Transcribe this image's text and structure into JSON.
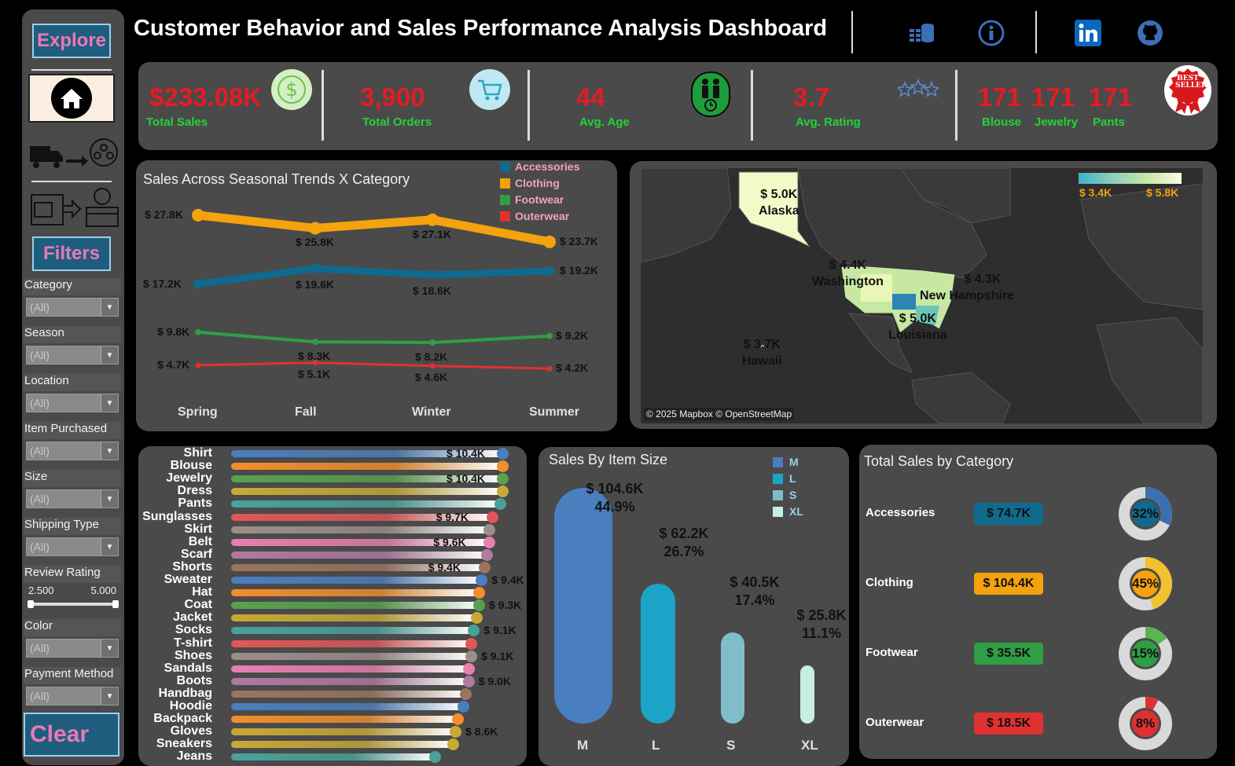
{
  "header": {
    "title": "Customer Behavior and Sales Performance Analysis Dashboard",
    "icons": [
      "data-source-icon",
      "info-icon",
      "linkedin-icon",
      "github-icon"
    ]
  },
  "sidebar": {
    "explore_label": "Explore",
    "filters_label": "Filters",
    "clear_label": "Clear",
    "filters": [
      {
        "label": "Category",
        "value": "(All)"
      },
      {
        "label": "Season",
        "value": "(All)"
      },
      {
        "label": "Location",
        "value": "(All)"
      },
      {
        "label": "Item Purchased",
        "value": "(All)"
      },
      {
        "label": "Size",
        "value": "(All)"
      },
      {
        "label": "Shipping Type",
        "value": "(All)"
      }
    ],
    "review_rating": {
      "label": "Review Rating",
      "min": "2.500",
      "max": "5.000"
    },
    "filters2": [
      {
        "label": "Color",
        "value": "(All)"
      },
      {
        "label": "Payment Method",
        "value": "(All)"
      }
    ]
  },
  "kpi": {
    "total_sales": {
      "value": "$233.08K",
      "label": "Total Sales"
    },
    "total_orders": {
      "value": "3,900",
      "label": "Total Orders"
    },
    "avg_age": {
      "value": "44",
      "label": "Avg. Age"
    },
    "avg_rating": {
      "value": "3.7",
      "label": "Avg. Rating"
    },
    "best_sellers": [
      {
        "value": "171",
        "label": "Blouse"
      },
      {
        "value": "171",
        "label": "Jewelry"
      },
      {
        "value": "171",
        "label": "Pants"
      }
    ],
    "best_seller_badge": "BEST SELLER"
  },
  "colors": {
    "accessories": "#0f6a8e",
    "clothing": "#f4a20d",
    "footwear": "#2f9e44",
    "outerwear": "#e03131",
    "kpi_value": "#e31c25",
    "kpi_label": "#22d33a"
  },
  "chart_data": [
    {
      "type": "line",
      "title": "Sales Across Seasonal Trends X Category",
      "categories": [
        "Spring",
        "Fall",
        "Winter",
        "Summer"
      ],
      "series": [
        {
          "name": "Accessories",
          "values": [
            17.2,
            19.6,
            18.6,
            19.2
          ],
          "labels": [
            "$ 17.2K",
            "$ 19.6K",
            "$ 18.6K",
            "$ 19.2K"
          ]
        },
        {
          "name": "Clothing",
          "values": [
            27.8,
            25.8,
            27.1,
            23.7
          ],
          "labels": [
            "$ 27.8K",
            "$ 25.8K",
            "$ 27.1K",
            "$ 23.7K"
          ]
        },
        {
          "name": "Footwear",
          "values": [
            9.8,
            8.3,
            8.2,
            9.2
          ],
          "labels": [
            "$ 9.8K",
            "$ 8.3K",
            "$ 8.2K",
            "$ 9.2K"
          ]
        },
        {
          "name": "Outerwear",
          "values": [
            4.7,
            5.1,
            4.6,
            4.2
          ],
          "labels": [
            "$ 4.7K",
            "$ 5.1K",
            "$ 4.6K",
            "$ 4.2K"
          ]
        }
      ]
    },
    {
      "type": "bar",
      "title": "",
      "categories": [
        "Shirt",
        "Blouse",
        "Jewelry",
        "Dress",
        "Pants",
        "Sunglasses",
        "Skirt",
        "Belt",
        "Scarf",
        "Shorts",
        "Sweater",
        "Hat",
        "Coat",
        "Jacket",
        "Socks",
        "T-shirt",
        "Shoes",
        "Sandals",
        "Boots",
        "Handbag",
        "Hoodie",
        "Backpack",
        "Gloves",
        "Sneakers",
        "Jeans"
      ],
      "values": [
        10.4,
        10.4,
        10.4,
        10.4,
        10.3,
        10.0,
        9.9,
        9.9,
        9.8,
        9.7,
        9.6,
        9.5,
        9.5,
        9.4,
        9.3,
        9.2,
        9.2,
        9.1,
        9.1,
        9.0,
        8.9,
        8.7,
        8.6,
        8.5,
        7.8
      ],
      "labels": [
        "$ 10.4K",
        "",
        "$ 10.4K",
        "",
        "",
        "$ 9.7K",
        "",
        "$ 9.6K",
        "",
        "$ 9.4K",
        "$ 9.4K",
        "",
        "$ 9.3K",
        "",
        "$ 9.1K",
        "",
        "$ 9.1K",
        "",
        "$ 9.0K",
        "",
        "",
        "",
        "$ 8.6K",
        "",
        ""
      ],
      "colors": [
        "#4a7fbf",
        "#f28e2b",
        "#59a14f",
        "#c8a936",
        "#49a29a",
        "#e15759",
        "#9c8f8a",
        "#e77fb0",
        "#b07aa1",
        "#9c755f",
        "#4a7fbf",
        "#f28e2b",
        "#59a14f",
        "#c8a936",
        "#49a29a",
        "#e15759",
        "#9c8f8a",
        "#e77fb0",
        "#b07aa1",
        "#9c755f",
        "#4a7fbf",
        "#f28e2b",
        "#c8a936",
        "#c8a936",
        "#49a29a"
      ]
    },
    {
      "type": "bar",
      "title": "Sales By Item Size",
      "categories": [
        "M",
        "L",
        "S",
        "XL"
      ],
      "values": [
        104.6,
        62.2,
        40.5,
        25.8
      ],
      "value_labels": [
        "$ 104.6K",
        "$ 62.2K",
        "$ 40.5K",
        "$ 25.8K"
      ],
      "pct_labels": [
        "44.9%",
        "26.7%",
        "17.4%",
        "11.1%"
      ],
      "colors": [
        "#4a7fbf",
        "#1ea3c8",
        "#80bdc9",
        "#c6eee3"
      ],
      "legend": [
        "M",
        "L",
        "S",
        "XL"
      ]
    },
    {
      "type": "pie",
      "title": "Total Sales by Category",
      "categories": [
        "Accessories",
        "Clothing",
        "Footwear",
        "Outerwear"
      ],
      "values": [
        74.7,
        104.4,
        35.5,
        18.5
      ],
      "value_labels": [
        "$ 74.7K",
        "$ 104.4K",
        "$ 35.5K",
        "$ 18.5K"
      ],
      "pct": [
        32,
        45,
        15,
        8
      ],
      "pct_labels": [
        "32%",
        "45%",
        "15%",
        "8%"
      ]
    }
  ],
  "map": {
    "legend_min": "$ 3.4K",
    "legend_max": "$ 5.8K",
    "credit": "© 2025 Mapbox © OpenStreetMap",
    "labels": [
      {
        "value": "$ 5.0K",
        "state": "Alaska"
      },
      {
        "value": "$ 4.4K",
        "state": "Washington"
      },
      {
        "value": "$ 4.3K",
        "state": "New Hampshire"
      },
      {
        "value": "$ 5.0K",
        "state": "Louisiana"
      },
      {
        "value": "$ 3.7K",
        "state": "Hawaii"
      }
    ]
  }
}
